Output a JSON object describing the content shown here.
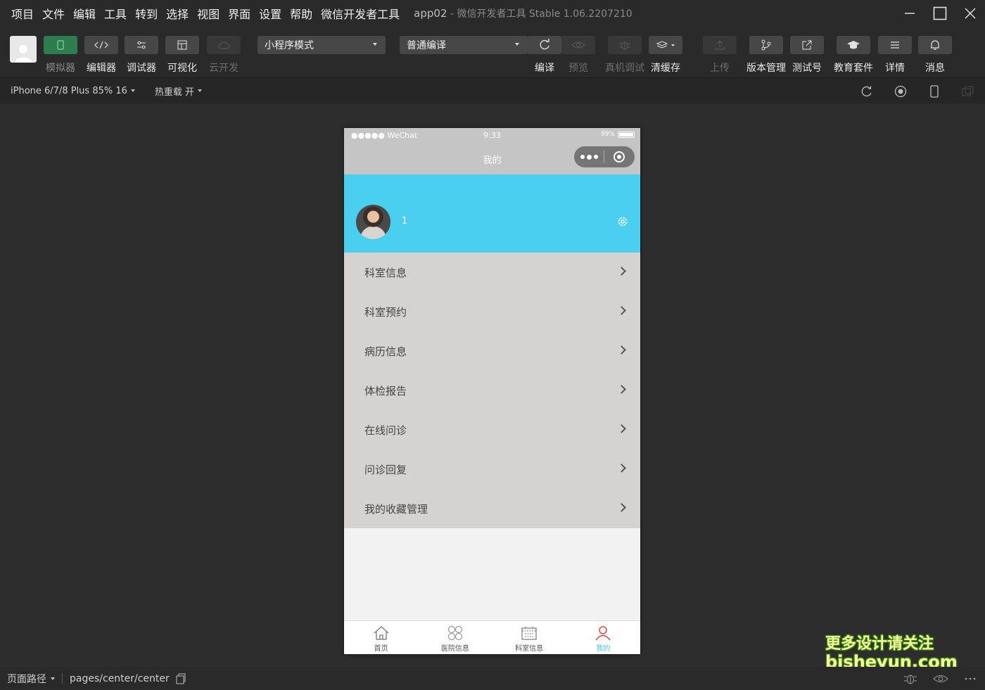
{
  "menubar": {
    "items": [
      "项目",
      "文件",
      "编辑",
      "工具",
      "转到",
      "选择",
      "视图",
      "界面",
      "设置",
      "帮助",
      "微信开发者工具"
    ],
    "project": "app02",
    "title": "微信开发者工具 Stable 1.06.2207210"
  },
  "toolbar": {
    "simulator": "模拟器",
    "editor": "编辑器",
    "debugger": "调试器",
    "visual": "可视化",
    "cloud": "云开发",
    "mode_select": "小程序模式",
    "compile_select": "普通编译",
    "compile": "编译",
    "preview": "预览",
    "remote_debug": "真机调试",
    "clear_cache": "清缓存",
    "upload": "上传",
    "version": "版本管理",
    "test_account": "测试号",
    "edu": "教育套件",
    "details": "详情",
    "messages": "消息",
    "accent": "#2e7d4f"
  },
  "subbar": {
    "device": "iPhone 6/7/8 Plus 85% 16",
    "hot_reload": "热重载 开"
  },
  "phone": {
    "carrier": "●●●●● WeChat",
    "time": "9:33",
    "battery": "99%",
    "nav_title": "我的",
    "username": "1",
    "header_color": "#4bcff0",
    "menu": [
      {
        "label": "科室信息"
      },
      {
        "label": "科室预约"
      },
      {
        "label": "病历信息"
      },
      {
        "label": "体检报告"
      },
      {
        "label": "在线问诊"
      },
      {
        "label": "问诊回复"
      },
      {
        "label": "我的收藏管理"
      }
    ],
    "tabs": [
      {
        "label": "首页",
        "icon": "home-icon"
      },
      {
        "label": "医院信息",
        "icon": "grid-icon"
      },
      {
        "label": "科室信息",
        "icon": "calendar-icon"
      },
      {
        "label": "我的",
        "icon": "user-icon",
        "active": true
      }
    ]
  },
  "footer": {
    "path_label": "页面路径",
    "path": "pages/center/center"
  },
  "watermark": {
    "line1": "更多设计请关注",
    "line2": "bisheyun.com"
  }
}
